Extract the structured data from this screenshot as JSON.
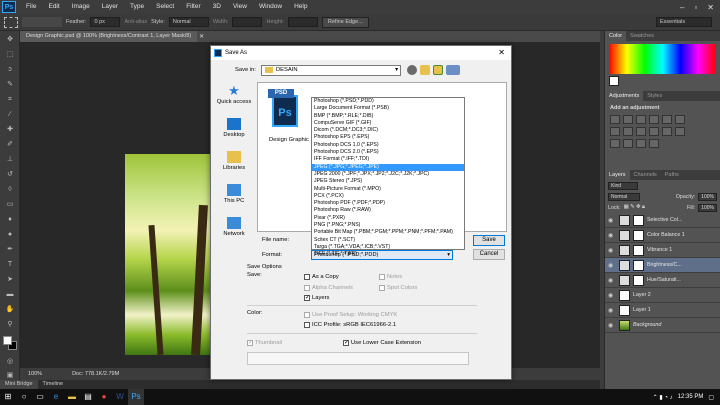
{
  "app": {
    "logo": "Ps"
  },
  "menu": [
    "File",
    "Edit",
    "Image",
    "Layer",
    "Type",
    "Select",
    "Filter",
    "3D",
    "View",
    "Window",
    "Help"
  ],
  "options": {
    "feather_label": "Feather:",
    "feather_value": "0 px",
    "antialias": "Anti-alias",
    "style_label": "Style:",
    "style_value": "Normal",
    "width_label": "Width:",
    "height_label": "Height:",
    "refine": "Refine Edge...",
    "workspace": "Essentials"
  },
  "document": {
    "title": "Design Graphic.psd @ 100% (Brightness/Contrast 1, Layer Mask/8)"
  },
  "status": {
    "zoom": "100%",
    "doc": "Doc: 778.1K/2.79M"
  },
  "bottom_tabs": [
    "Mini Bridge",
    "Timeline"
  ],
  "panels": {
    "color_tabs": [
      "Color",
      "Swatches"
    ],
    "adj_tabs": [
      "Adjustments",
      "Styles"
    ],
    "adj_title": "Add an adjustment",
    "layer_tabs": [
      "Layers",
      "Channels",
      "Paths"
    ],
    "kind": "Kind",
    "blend": "Normal",
    "opacity_label": "Opacity:",
    "opacity": "100%",
    "lock_label": "Lock:",
    "fill_label": "Fill:",
    "fill": "100%"
  },
  "layers": [
    {
      "name": "Selective Col...",
      "selected": false
    },
    {
      "name": "Color Balance 1",
      "selected": false
    },
    {
      "name": "Vibrance 1",
      "selected": false
    },
    {
      "name": "Brightness/C...",
      "selected": true
    },
    {
      "name": "Hue/Saturati...",
      "selected": false
    },
    {
      "name": "Layer 2",
      "selected": false
    },
    {
      "name": "Layer 1",
      "selected": false
    },
    {
      "name": "Background",
      "selected": false
    }
  ],
  "dialog": {
    "title": "Save As",
    "save_in_label": "Save in:",
    "save_in_value": "DESAIN",
    "places": [
      "Quick access",
      "Desktop",
      "Libraries",
      "This PC",
      "Network"
    ],
    "file_badge": "PSD",
    "file_icon_text": "Ps",
    "file_name_display": "Design Graphic",
    "file_name_label": "File name:",
    "format_label": "Format:",
    "format_value": "Photoshop (*.PSD;*.PDD)",
    "save_btn": "Save",
    "cancel_btn": "Cancel",
    "formats": [
      "Photoshop (*.PSD;*.PDD)",
      "Large Document Format (*.PSB)",
      "BMP (*.BMP;*.RLE;*.DIB)",
      "CompuServe GIF (*.GIF)",
      "Dicom (*.DCM;*.DC3;*.DIC)",
      "Photoshop EPS (*.EPS)",
      "Photoshop DCS 1.0 (*.EPS)",
      "Photoshop DCS 2.0 (*.EPS)",
      "IFF Format (*.IFF;*.TDI)",
      "JPEG (*.JPG;*.JPEG;*.JPE)",
      "JPEG 2000 (*.JPF;*.JPX;*.JP2;*.J2C;*.J2K;*.JPC)",
      "JPEG Stereo (*.JPS)",
      "Multi-Picture Format (*.MPO)",
      "PCX (*.PCX)",
      "Photoshop PDF (*.PDF;*.PDP)",
      "Photoshop Raw (*.RAW)",
      "Pixar (*.PXR)",
      "PNG (*.PNG;*.PNS)",
      "Portable Bit Map (*.PBM;*.PGM;*.PPM;*.PNM;*.PFM;*.PAM)",
      "Scitex CT (*.SCT)",
      "Targa (*.TGA;*.VDA;*.ICB;*.VST)",
      "TIFF (*.TIF;*.TIFF)"
    ],
    "highlighted_index": 9,
    "save_options": "Save Options",
    "save_label": "Save:",
    "as_copy": "As a Copy",
    "notes": "Notes",
    "alpha": "Alpha Channels",
    "spot": "Spot Colors",
    "layers": "Layers",
    "color_label": "Color:",
    "proof": "Use Proof Setup:  Working CMYK",
    "icc": "ICC Profile:  sRGB IEC61966-2.1",
    "thumbnail": "Thumbnail",
    "lowercase": "Use Lower Case Extension"
  },
  "taskbar": {
    "time": "12:35 PM"
  }
}
